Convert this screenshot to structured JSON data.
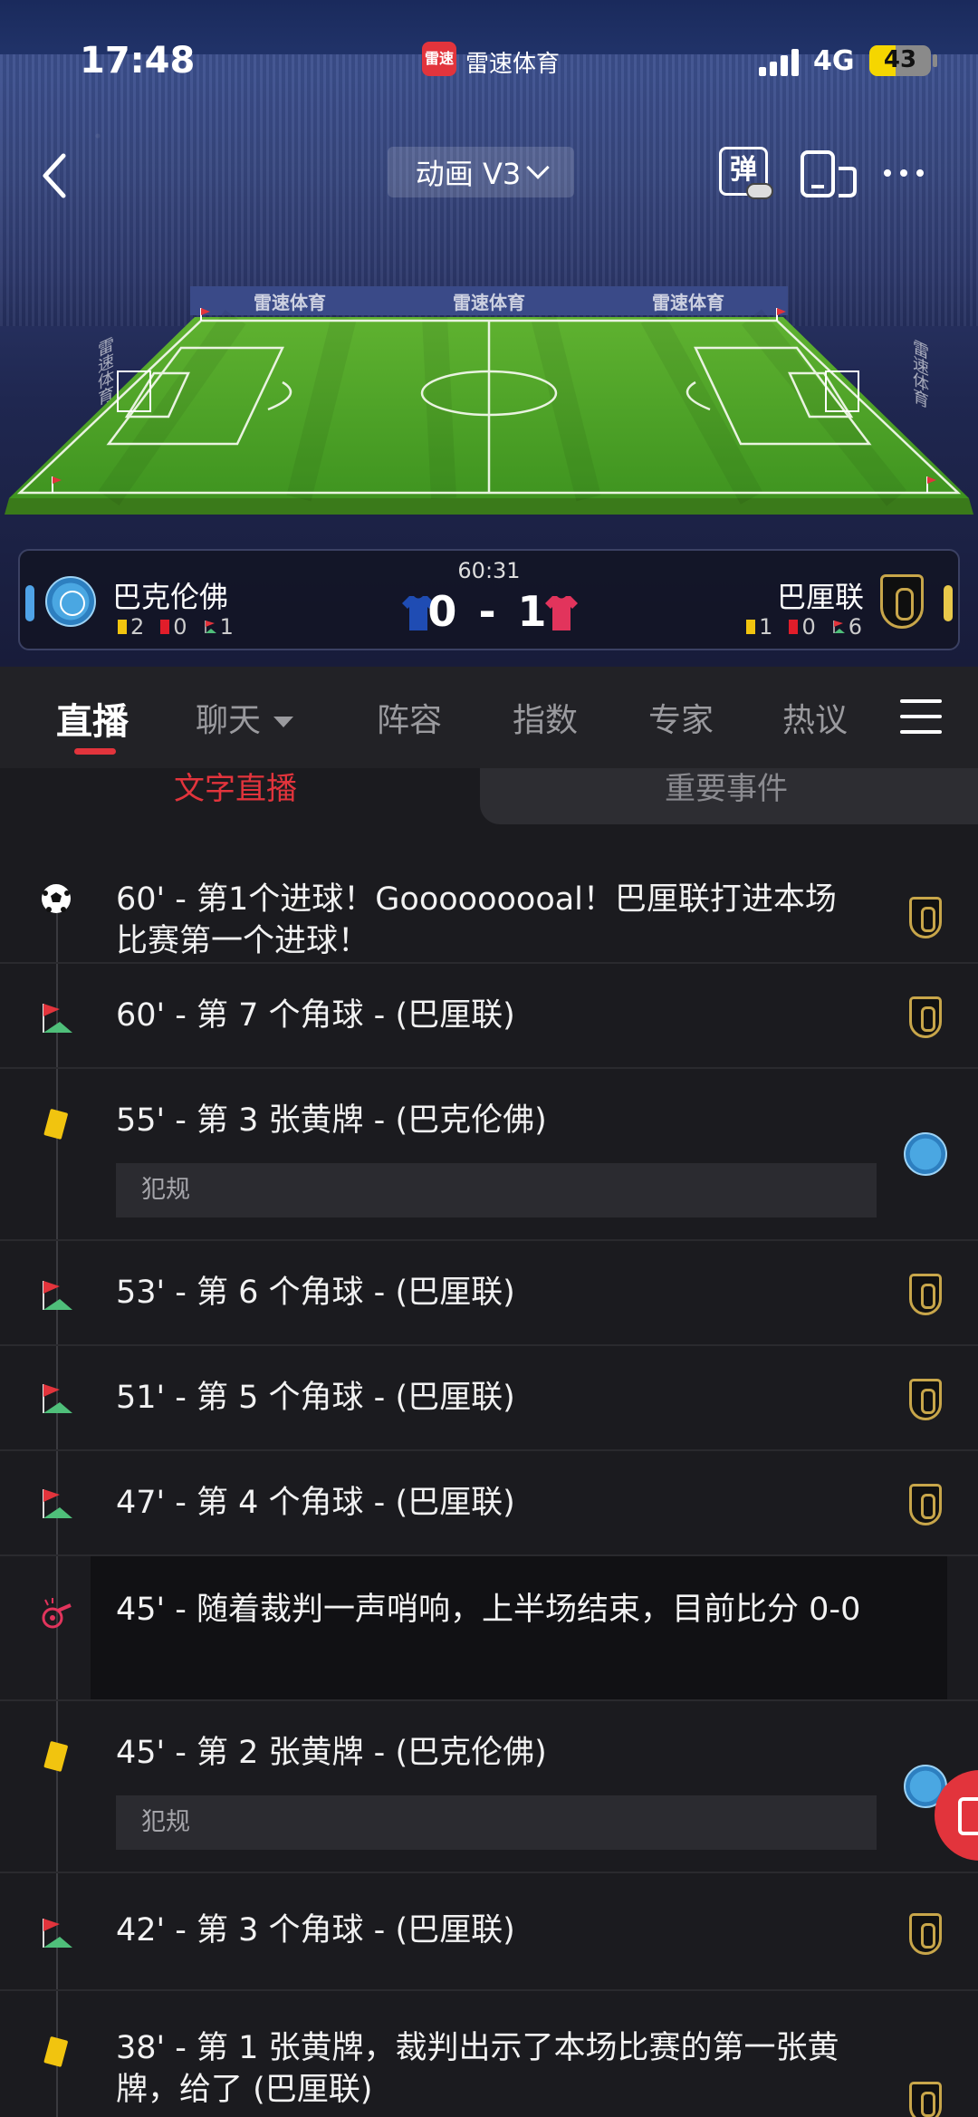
{
  "status_bar": {
    "time": "17:48",
    "app_logo": "雷速",
    "app_name": "雷速体育",
    "network": "4G",
    "battery": "43",
    "battery_level": 0.43
  },
  "nav": {
    "mode_label": "动画 V3",
    "danmu_label": "弹"
  },
  "stadium": {
    "board_text": "雷速体育"
  },
  "match": {
    "time": "60:31",
    "score": "0 - 1",
    "home": {
      "name": "巴克伦佛",
      "yellow": "2",
      "red": "0",
      "corners": "1"
    },
    "away": {
      "name": "巴厘联",
      "yellow": "1",
      "red": "0",
      "corners": "6"
    }
  },
  "tabs": [
    {
      "label": "直播"
    },
    {
      "label": "聊天"
    },
    {
      "label": "阵容"
    },
    {
      "label": "指数"
    },
    {
      "label": "专家"
    },
    {
      "label": "热议"
    }
  ],
  "subtabs": {
    "active": "文字直播",
    "inactive": "重要事件"
  },
  "events": [
    {
      "icon": "football-icon",
      "text": "60' - 第1个进球！Gooooooooal！巴厘联打进本场比赛第一个进球！",
      "team": "away"
    },
    {
      "icon": "corner-flag-icon",
      "text": "60' - 第 7 个角球 - (巴厘联)",
      "team": "away"
    },
    {
      "icon": "yellow-card-icon",
      "text": "55' - 第 3 张黄牌 - (巴克伦佛)",
      "note": "犯规",
      "team": "home"
    },
    {
      "icon": "corner-flag-icon",
      "text": "53' - 第 6 个角球 - (巴厘联)",
      "team": "away"
    },
    {
      "icon": "corner-flag-icon",
      "text": "51' - 第 5 个角球 - (巴厘联)",
      "team": "away"
    },
    {
      "icon": "corner-flag-icon",
      "text": "47' - 第 4 个角球 - (巴厘联)",
      "team": "away"
    },
    {
      "icon": "whistle-icon",
      "text": "45' - 随着裁判一声哨响，上半场结束，目前比分 0-0",
      "team": "none"
    },
    {
      "icon": "yellow-card-icon",
      "text": "45' - 第 2 张黄牌 - (巴克伦佛)",
      "note": "犯规",
      "team": "home"
    },
    {
      "icon": "corner-flag-icon",
      "text": "42' - 第 3 个角球 - (巴厘联)",
      "team": "away"
    },
    {
      "icon": "yellow-card-icon",
      "text": "38' - 第 1 张黄牌，裁判出示了本场比赛的第一张黄牌，给了 (巴厘联)",
      "team": "away"
    }
  ]
}
